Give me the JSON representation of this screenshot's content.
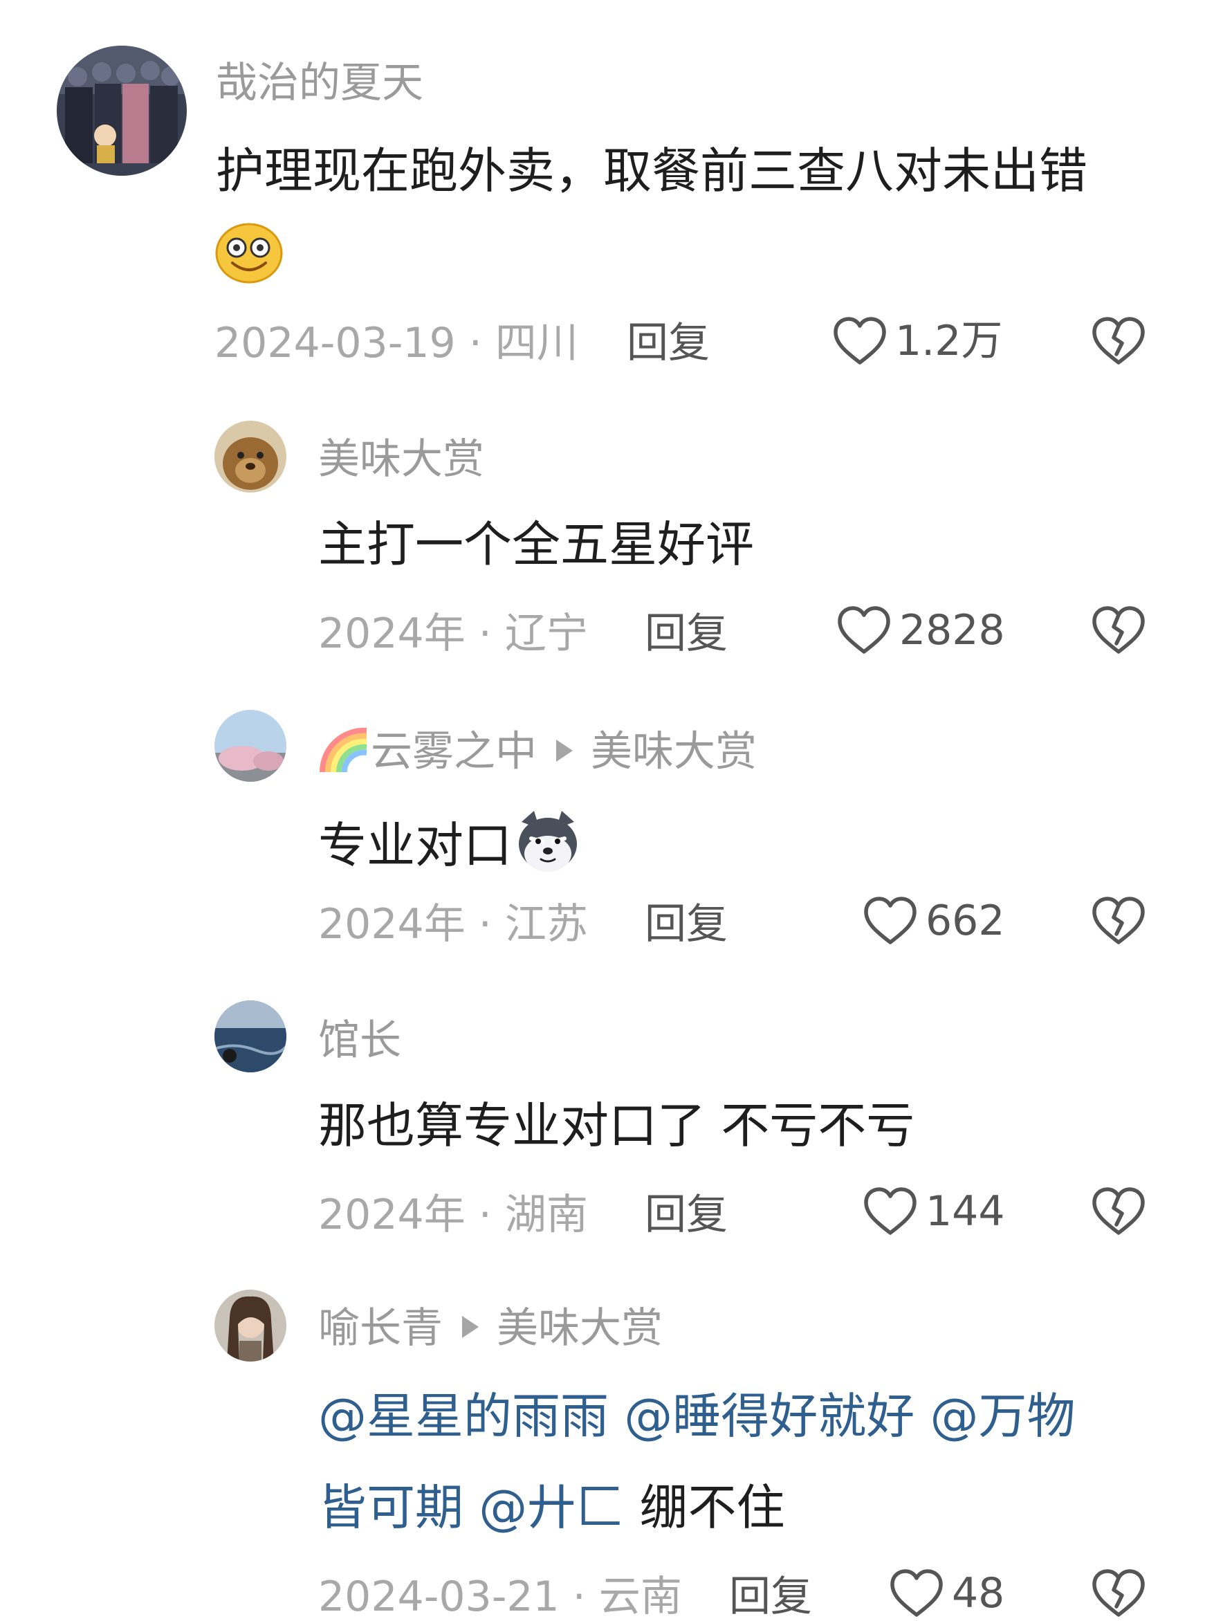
{
  "comments": [
    {
      "user": "哉治的夏天",
      "content_line1": "护理现在跑外卖，取餐前三查八对未出错",
      "emoji": "smiley-emoji",
      "date": "2024-03-19",
      "region": "四川",
      "reply": "回复",
      "likes": "1.2万"
    },
    {
      "user": "美味大赏",
      "content": "主打一个全五星好评",
      "date": "2024年",
      "region": "辽宁",
      "reply": "回复",
      "likes": "2828"
    },
    {
      "user": "云雾之中",
      "user_icon": "rainbow-icon",
      "reply_to": "美味大赏",
      "content": "专业对口",
      "emoji": "husky-emoji",
      "date": "2024年",
      "region": "江苏",
      "reply": "回复",
      "likes": "662"
    },
    {
      "user": "馆长",
      "content": "那也算专业对口了 不亏不亏",
      "date": "2024年",
      "region": "湖南",
      "reply": "回复",
      "likes": "144"
    },
    {
      "user": "喻长青",
      "reply_to": "美味大赏",
      "mentions": [
        "@星星的雨雨",
        "@睡得好就好",
        "@万物",
        "皆可期",
        "@廾匚"
      ],
      "content_tail": "绷不住",
      "date": "2024-03-21",
      "region": "云南",
      "reply": "回复",
      "likes": "48"
    }
  ],
  "colors": {
    "mention": "#2f5f8f",
    "meta": "#a8a8a8",
    "name": "#9a9a9a"
  }
}
